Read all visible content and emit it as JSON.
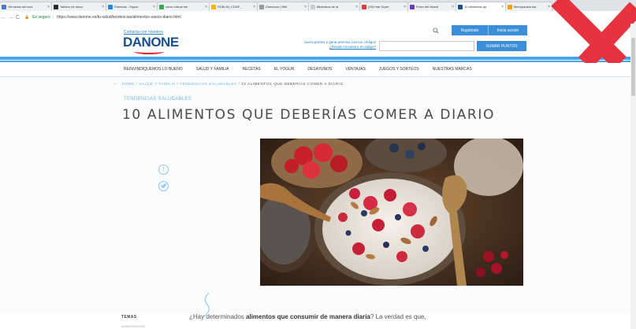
{
  "tabs": [
    {
      "label": "Ver tarea del curs",
      "color": "#4a79c8",
      "active": false
    },
    {
      "label": "Tablero de discu",
      "color": "#2b2b2b",
      "active": false
    },
    {
      "label": "Rúbricas - Espac",
      "color": "#1e88e5",
      "active": false
    },
    {
      "label": "curso virtual me",
      "color": "#34a853",
      "active": false
    },
    {
      "label": "RÚBLIN_CONF_",
      "color": "#f5b400",
      "active": false
    },
    {
      "label": "Directorio | Bibl",
      "color": "#999999",
      "active": false
    },
    {
      "label": "Biblioteca de la ",
      "color": "#cccccc",
      "active": false
    },
    {
      "label": "(29) Hair Dryer",
      "color": "#e53935",
      "active": false
    },
    {
      "label": "Porre del Mundi",
      "color": "#6a3fb5",
      "active": false
    },
    {
      "label": "10 alimentos qu",
      "color": "#1a4f8f",
      "active": true
    },
    {
      "label": "Menopausia dar",
      "color": "#f59e0b",
      "active": false
    }
  ],
  "browser": {
    "secure_label": "Es seguro",
    "url": "https://www.danone.es/tu-salud/tendencias/alimentos-sanos-diario.html"
  },
  "header": {
    "contact": "Contacta con nosotros",
    "logo": "DANONE",
    "register": "Registrate",
    "login": "Inicia sesión",
    "promo_line1": "Suma puntos y gana premios con tus códigos",
    "promo_line2": "¿Dónde encuentro el código?",
    "sum_button": "SUMAR PUNTOS",
    "code_placeholder": ""
  },
  "menu": [
    "REINVINDIQUEMOS LO BUENO",
    "SALUD Y FAMILIA",
    "RECETAS",
    "EL YOGUR",
    "DESAYUNOS",
    "VENTAJAS",
    "JUEGOS Y SORTEOS",
    "NUESTRAS MARCAS"
  ],
  "breadcrumb": {
    "home": "HOME",
    "section": "SALUD Y FAMILIA",
    "category": "TENDENCIAS SALUDABLES",
    "current": "10 ALIMENTOS QUE DEBERÍAS COMER A DIARIO"
  },
  "article": {
    "category": "TENDENCIAS SALUDABLES",
    "title": "10 ALIMENTOS QUE DEBERÍAS COMER A DIARIO",
    "temas": "TEMAS",
    "temas_sub": "ALIMENTACIÓN",
    "intro_pre": "¿Hay determinados ",
    "intro_bold": "alimentos que consumir de manera diaria",
    "intro_post": "? La verdad es que,"
  },
  "colors": {
    "accent": "#3b8fd8",
    "brand": "#1a4f8f",
    "stripe": "#4aa3e4",
    "overlay_x": "#e8323f"
  }
}
